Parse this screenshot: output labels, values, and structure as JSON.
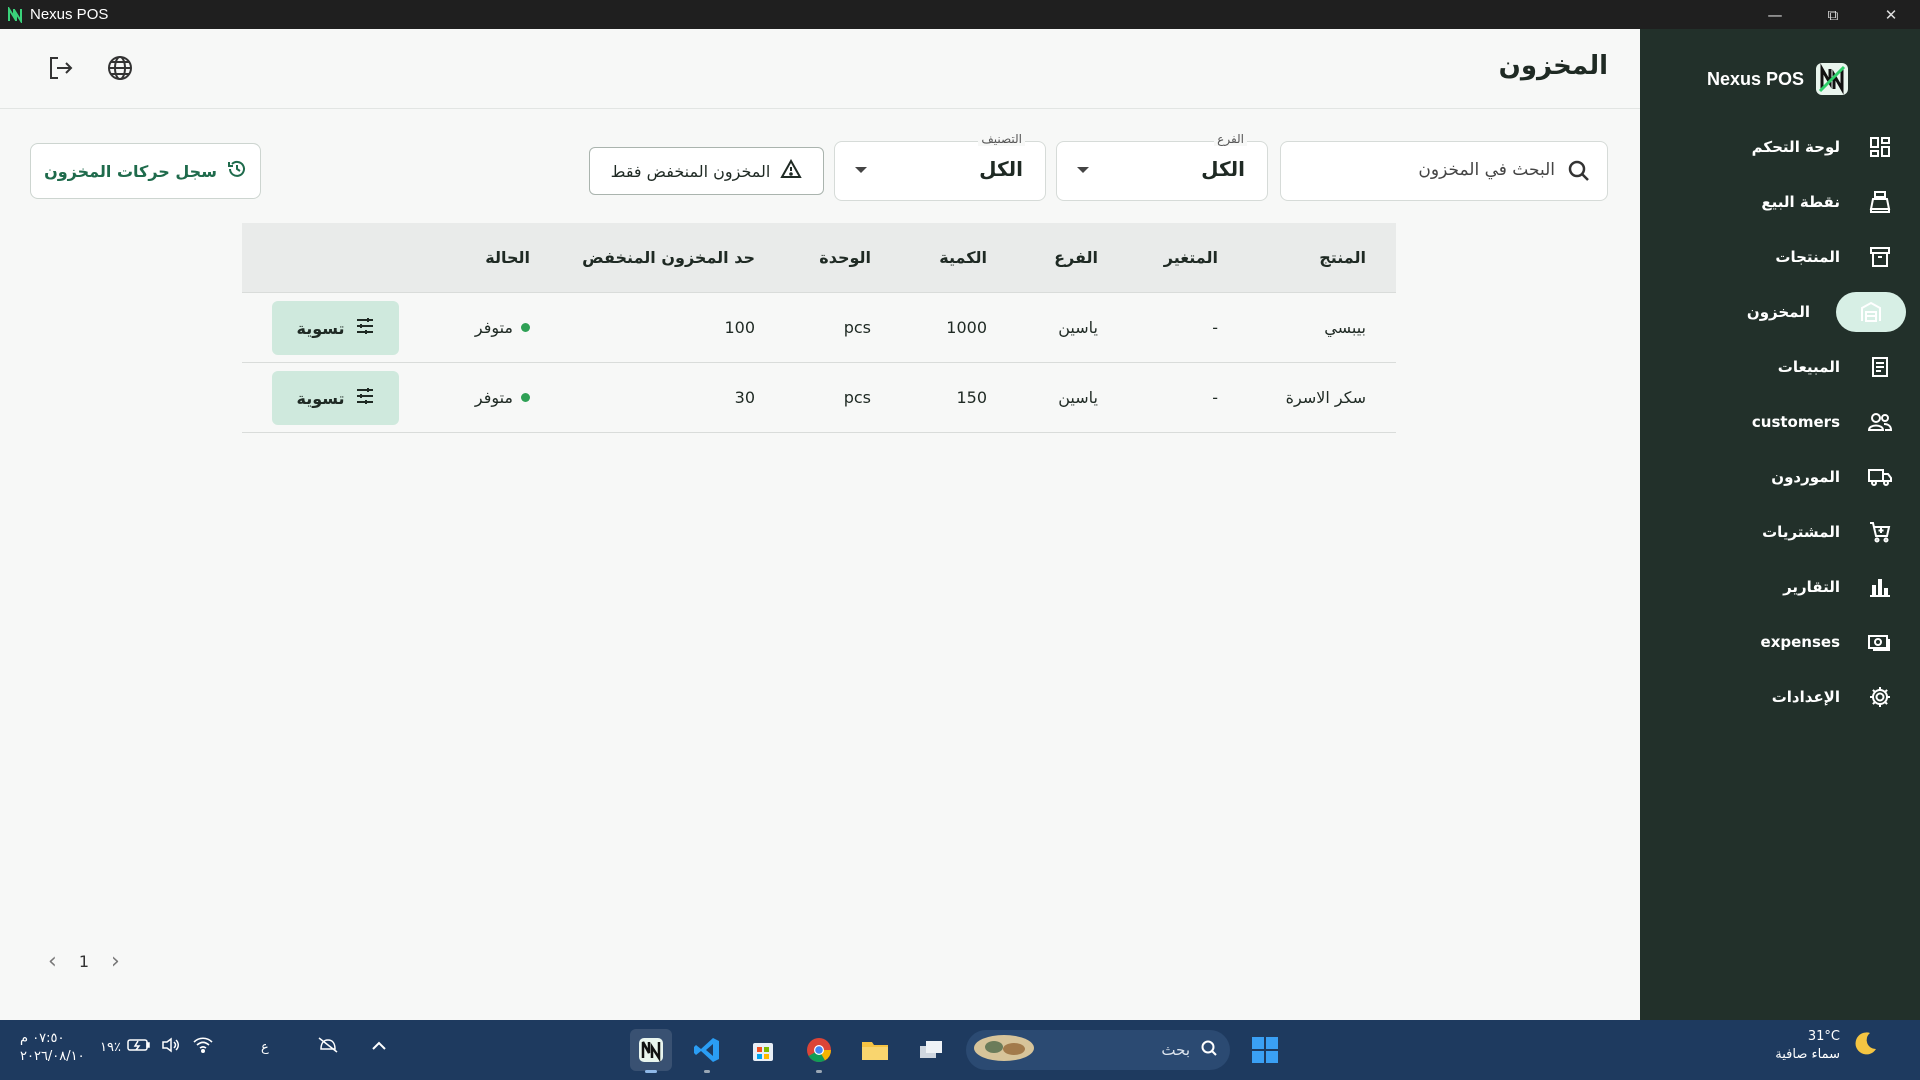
{
  "window": {
    "title": "Nexus POS",
    "minimize": "—",
    "maximize": "⧉",
    "close": "✕"
  },
  "sidebar": {
    "brand": "Nexus POS",
    "items": [
      {
        "label": "لوحة التحكم",
        "icon": "dashboard-icon",
        "active": false
      },
      {
        "label": "نقطة البيع",
        "icon": "cash-register-icon",
        "active": false
      },
      {
        "label": "المنتجات",
        "icon": "archive-box-icon",
        "active": false
      },
      {
        "label": "المخزون",
        "icon": "warehouse-icon",
        "active": true
      },
      {
        "label": "المبيعات",
        "icon": "receipt-icon",
        "active": false
      },
      {
        "label": "customers",
        "icon": "users-icon",
        "active": false
      },
      {
        "label": "الموردون",
        "icon": "truck-icon",
        "active": false
      },
      {
        "label": "المشتريات",
        "icon": "cart-icon",
        "active": false
      },
      {
        "label": "التقارير",
        "icon": "bar-chart-icon",
        "active": false
      },
      {
        "label": "expenses",
        "icon": "money-icon",
        "active": false
      },
      {
        "label": "الإعدادات",
        "icon": "gear-icon",
        "active": false
      }
    ]
  },
  "header": {
    "title": "المخزون"
  },
  "filters": {
    "search_placeholder": "البحث في المخزون",
    "branch": {
      "label": "الفرع",
      "value": "الكل"
    },
    "category": {
      "label": "التصنيف",
      "value": "الكل"
    },
    "low_stock_label": "المخزون المنخفض فقط",
    "history_label": "سجل حركات المخزون"
  },
  "table": {
    "headers": {
      "product": "المنتج",
      "variant": "المتغير",
      "branch": "الفرع",
      "quantity": "الكمية",
      "unit": "الوحدة",
      "threshold": "حد المخزون المنخفض",
      "status": "الحالة"
    },
    "rows": [
      {
        "product": "بيبسي",
        "variant": "-",
        "branch": "ياسين",
        "quantity": "1000",
        "unit": "pcs",
        "threshold": "100",
        "status": "متوفر",
        "action": "تسوية"
      },
      {
        "product": "سكر الاسرة",
        "variant": "-",
        "branch": "ياسين",
        "quantity": "150",
        "unit": "pcs",
        "threshold": "30",
        "status": "متوفر",
        "action": "تسوية"
      }
    ]
  },
  "pagination": {
    "page": "1",
    "prev": "‹",
    "next": "›"
  },
  "taskbar": {
    "temp": "31°C",
    "weather": "سماء صافية",
    "search_placeholder": "بحث",
    "lang": "ع",
    "battery": "١٩٪",
    "time": "٠٧:٥٠ م",
    "date": "٢٠٢٦/٠٨/١٠"
  },
  "colors": {
    "sidebar": "#22302a",
    "accent": "#1f6b4c",
    "active_pill": "#d7efe5",
    "status_ok": "#2ea055",
    "taskbar": "#1e3a5f"
  }
}
